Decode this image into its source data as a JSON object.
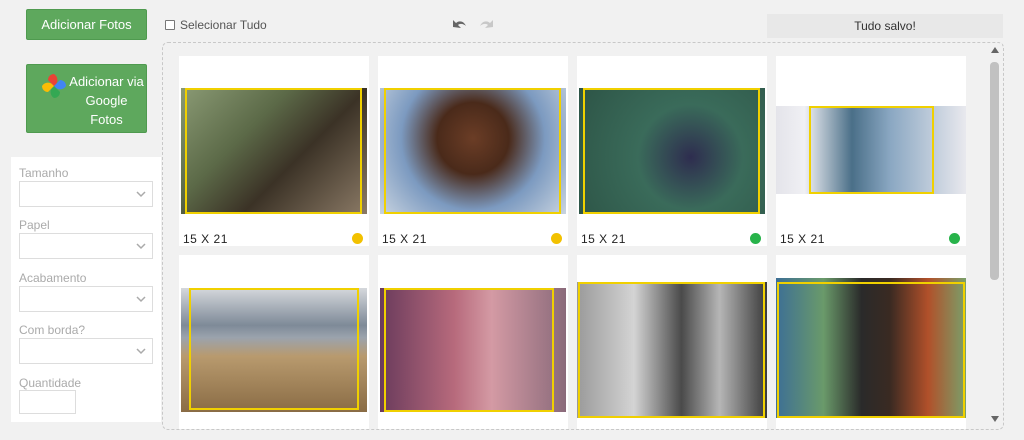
{
  "toolbar": {
    "add_photos_label": "Adicionar Fotos",
    "google_photos_label": "Adicionar via Google Fotos",
    "select_all_label": "Selecionar Tudo",
    "undo_icon": "undo-icon",
    "redo_icon": "redo-icon",
    "status_text": "Tudo salvo!"
  },
  "options": {
    "size_label": "Tamanho",
    "paper_label": "Papel",
    "finish_label": "Acabamento",
    "border_label": "Com borda?",
    "quantity_label": "Quantidade",
    "size_value": "",
    "paper_value": "",
    "finish_value": "",
    "border_value": "",
    "quantity_value": ""
  },
  "photos": [
    {
      "size": "15 X 21",
      "status": "yellow-face-icon",
      "status_color": "#f2c100",
      "desc": "couple-horse"
    },
    {
      "size": "15 X 21",
      "status": "yellow-face-icon",
      "status_color": "#f2c100",
      "desc": "girl-smiling"
    },
    {
      "size": "15 X 21",
      "status": "green-face-icon",
      "status_color": "#27b34a",
      "desc": "girl-bubbles"
    },
    {
      "size": "15 X 21",
      "status": "green-face-icon",
      "status_color": "#27b34a",
      "desc": "father-child"
    },
    {
      "size": "",
      "status": "",
      "status_color": "",
      "desc": "mountains-field"
    },
    {
      "size": "",
      "status": "",
      "status_color": "",
      "desc": "family-kiss"
    },
    {
      "size": "",
      "status": "",
      "status_color": "",
      "desc": "mother-child-bw"
    },
    {
      "size": "",
      "status": "",
      "status_color": "",
      "desc": "two-men-embrace"
    }
  ],
  "colors": {
    "accent_green": "#5ea85d",
    "frame_yellow": "#f0d000"
  }
}
